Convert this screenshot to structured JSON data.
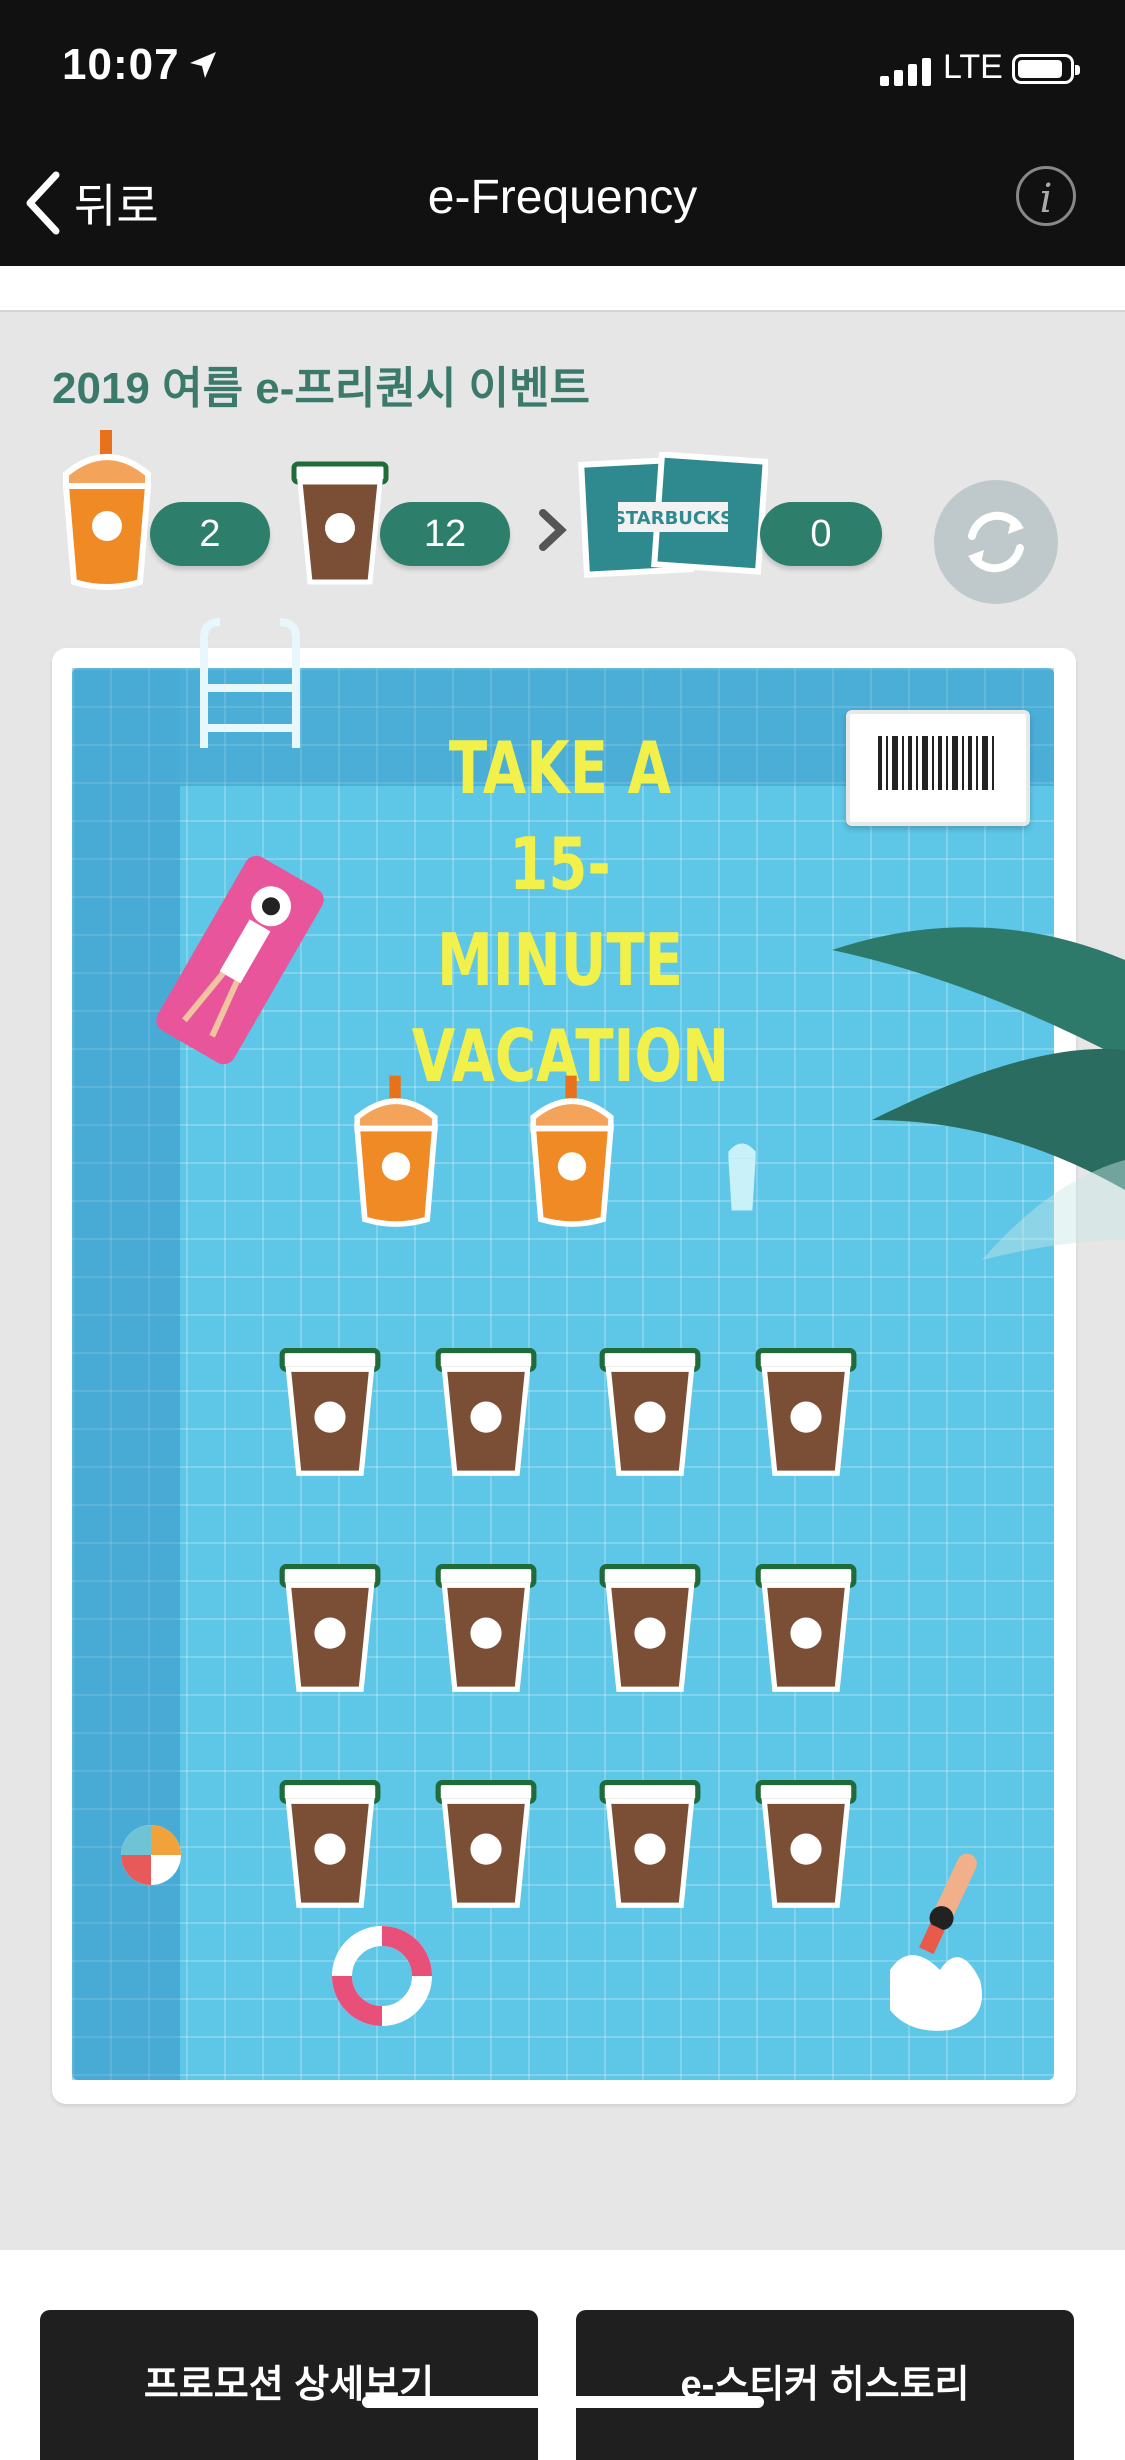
{
  "status_bar": {
    "time": "10:07",
    "network": "LTE"
  },
  "nav": {
    "back_label": "뒤로",
    "title": "e-Frequency"
  },
  "event": {
    "title": "2019 여름 e-프리퀀시 이벤트",
    "counters": [
      {
        "name": "mission-beverage",
        "value": "2"
      },
      {
        "name": "regular-beverage",
        "value": "12"
      },
      {
        "name": "sticker-reward",
        "value": "0"
      }
    ],
    "sticker_text": "STARBUCKS"
  },
  "stamp_card": {
    "headline_lines": [
      "TAKE A",
      "15-MINUTE",
      "VACATION"
    ],
    "mission_cups_filled": 2,
    "mission_cups_total": 3,
    "regular_cups_filled": 12,
    "regular_cups_total": 12
  },
  "buttons": {
    "promo_detail": "프로모션 상세보기",
    "sticker_history": "e-스티커 히스토리"
  },
  "colors": {
    "accent": "#2d7f6b",
    "pool": "#5ec6e6",
    "headline": "#f2f04a",
    "frappe": "#f08a24",
    "coffee": "#7a4f35"
  }
}
